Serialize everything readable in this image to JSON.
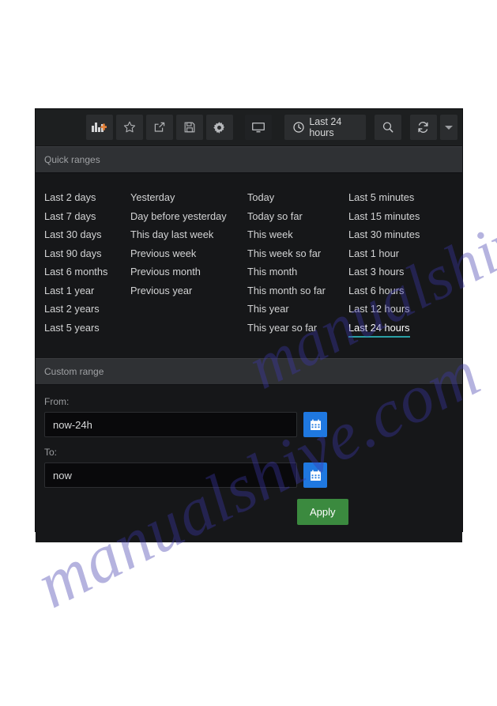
{
  "toolbar": {
    "buttons": [
      {
        "name": "add-panel-button",
        "icon": "bar-chart-plus-icon",
        "label": ""
      },
      {
        "name": "star-button",
        "icon": "star-icon",
        "label": ""
      },
      {
        "name": "share-button",
        "icon": "share-icon",
        "label": ""
      },
      {
        "name": "save-button",
        "icon": "save-floppy-icon",
        "label": ""
      },
      {
        "name": "settings-button",
        "icon": "gear-icon",
        "label": ""
      },
      {
        "name": "tv-mode-button",
        "icon": "monitor-icon",
        "label": ""
      }
    ],
    "time_picker": {
      "icon": "clock-icon",
      "label": "Last 24 hours"
    },
    "search_icon": "search-icon",
    "refresh_icon": "refresh-icon",
    "caret_icon": "chevron-down-icon"
  },
  "quick_ranges": {
    "header": "Quick ranges",
    "selected": "Last 24 hours",
    "columns": [
      {
        "items": [
          "Last 2 days",
          "Last 7 days",
          "Last 30 days",
          "Last 90 days",
          "Last 6 months",
          "Last 1 year",
          "Last 2 years",
          "Last 5 years"
        ]
      },
      {
        "items": [
          "Yesterday",
          "Day before yesterday",
          "This day last week",
          "Previous week",
          "Previous month",
          "Previous year"
        ]
      },
      {
        "items": [
          "Today",
          "Today so far",
          "This week",
          "This week so far",
          "This month",
          "This month so far",
          "This year",
          "This year so far"
        ]
      },
      {
        "items": [
          "Last 5 minutes",
          "Last 15 minutes",
          "Last 30 minutes",
          "Last 1 hour",
          "Last 3 hours",
          "Last 6 hours",
          "Last 12 hours",
          "Last 24 hours"
        ]
      }
    ]
  },
  "custom_range": {
    "header": "Custom range",
    "from": {
      "label": "From:",
      "value": "now-24h",
      "placeholder": "now-24h",
      "calendar_icon": "calendar-icon"
    },
    "to": {
      "label": "To:",
      "value": "now",
      "placeholder": "now",
      "calendar_icon": "calendar-icon"
    },
    "apply_label": "Apply"
  },
  "watermark": {
    "line1": "manualshive.com",
    "line2": "manualshive.com"
  },
  "colors": {
    "accent_teal": "#2a9fa4",
    "apply_green": "#3b8a3f",
    "calendar_blue": "#1f78e0",
    "plus_orange": "#e8833a",
    "panel_bg": "#161719",
    "toolbar_bg": "#1d1f20",
    "section_head_bg": "#2f3134"
  }
}
